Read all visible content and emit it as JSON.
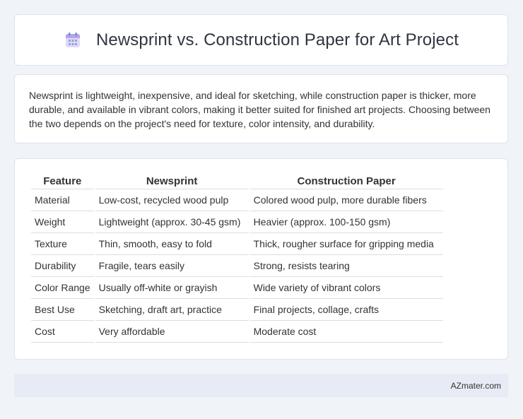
{
  "header": {
    "icon": "calendar-icon",
    "title": "Newsprint vs. Construction Paper for Art Project"
  },
  "intro": {
    "text": "Newsprint is lightweight, inexpensive, and ideal for sketching, while construction paper is thicker, more durable, and available in vibrant colors, making it better suited for finished art projects. Choosing between the two depends on the project's need for texture, color intensity, and durability."
  },
  "table": {
    "headers": [
      "Feature",
      "Newsprint",
      "Construction Paper"
    ],
    "rows": [
      [
        "Material",
        "Low-cost, recycled wood pulp",
        "Colored wood pulp, more durable fibers"
      ],
      [
        "Weight",
        "Lightweight (approx. 30-45 gsm)",
        "Heavier (approx. 100-150 gsm)"
      ],
      [
        "Texture",
        "Thin, smooth, easy to fold",
        "Thick, rougher surface for gripping media"
      ],
      [
        "Durability",
        "Fragile, tears easily",
        "Strong, resists tearing"
      ],
      [
        "Color Range",
        "Usually off-white or grayish",
        "Wide variety of vibrant colors"
      ],
      [
        "Best Use",
        "Sketching, draft art, practice",
        "Final projects, collage, crafts"
      ],
      [
        "Cost",
        "Very affordable",
        "Moderate cost"
      ]
    ]
  },
  "footer": {
    "text": "AZmater.com"
  }
}
